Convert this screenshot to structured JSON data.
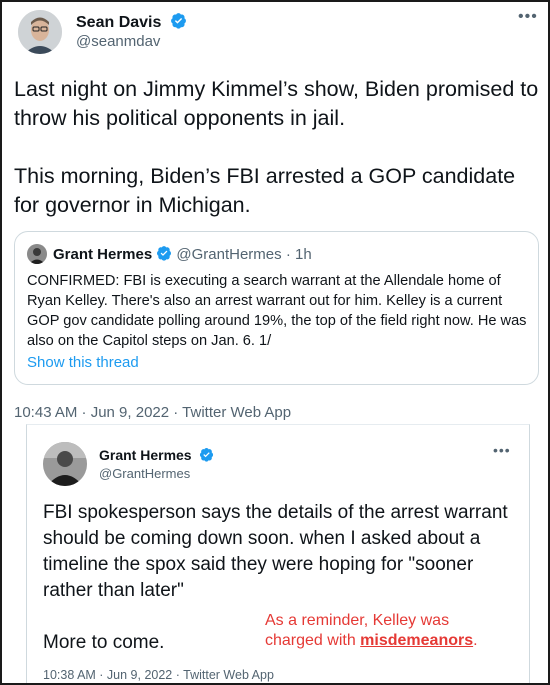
{
  "tweet": {
    "author_name": "Sean Davis",
    "handle": "@seanmdav",
    "paragraphs": [
      "Last night on Jimmy Kimmel’s show, Biden promised to throw his political opponents in jail.",
      "This morning, Biden’s FBI arrested a GOP candidate for governor in Michigan."
    ],
    "meta": "10:43 AM · Jun 9, 2022 · Twitter Web App"
  },
  "quote": {
    "author_name": "Grant Hermes",
    "handle": "@GrantHermes",
    "time": "1h",
    "text": "CONFIRMED: FBI is executing a search warrant at the Allendale home of Ryan Kelley. There's also an arrest warrant out for him. Kelley is a current GOP gov candidate polling around 19%, the top of the field right now. He was also on the Capitol steps on Jan. 6. 1/",
    "show_thread": "Show this thread"
  },
  "embedded": {
    "author_name": "Grant Hermes",
    "handle": "@GrantHermes",
    "paragraphs": [
      "FBI spokesperson says the details of the arrest warrant should be coming down soon. when I asked about a timeline the spox said they were hoping for \"sooner rather than later\"",
      "More to come."
    ],
    "meta": "10:38 AM · Jun 9, 2022 · Twitter Web App",
    "annotation_line1": "As a reminder, Kelley was",
    "annotation_line2_prefix": "charged with ",
    "annotation_emphasis": "misdemeanors",
    "annotation_suffix": "."
  },
  "icons": {
    "verified": "verified-badge-icon",
    "more": "more-options-icon"
  },
  "colors": {
    "verified": "#1d9bf0",
    "link": "#1d9bf0",
    "annotation": "#e53935",
    "secondary_text": "#536471"
  }
}
